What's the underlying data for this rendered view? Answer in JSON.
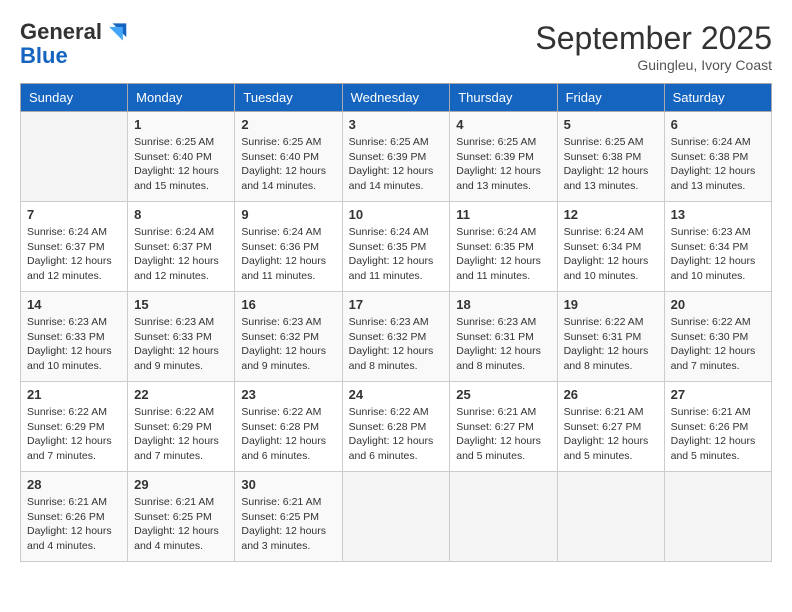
{
  "header": {
    "logo_line1": "General",
    "logo_line2": "Blue",
    "month_title": "September 2025",
    "subtitle": "Guingleu, Ivory Coast"
  },
  "days_of_week": [
    "Sunday",
    "Monday",
    "Tuesday",
    "Wednesday",
    "Thursday",
    "Friday",
    "Saturday"
  ],
  "weeks": [
    [
      {
        "day": "",
        "info": ""
      },
      {
        "day": "1",
        "info": "Sunrise: 6:25 AM\nSunset: 6:40 PM\nDaylight: 12 hours\nand 15 minutes."
      },
      {
        "day": "2",
        "info": "Sunrise: 6:25 AM\nSunset: 6:40 PM\nDaylight: 12 hours\nand 14 minutes."
      },
      {
        "day": "3",
        "info": "Sunrise: 6:25 AM\nSunset: 6:39 PM\nDaylight: 12 hours\nand 14 minutes."
      },
      {
        "day": "4",
        "info": "Sunrise: 6:25 AM\nSunset: 6:39 PM\nDaylight: 12 hours\nand 13 minutes."
      },
      {
        "day": "5",
        "info": "Sunrise: 6:25 AM\nSunset: 6:38 PM\nDaylight: 12 hours\nand 13 minutes."
      },
      {
        "day": "6",
        "info": "Sunrise: 6:24 AM\nSunset: 6:38 PM\nDaylight: 12 hours\nand 13 minutes."
      }
    ],
    [
      {
        "day": "7",
        "info": "Sunrise: 6:24 AM\nSunset: 6:37 PM\nDaylight: 12 hours\nand 12 minutes."
      },
      {
        "day": "8",
        "info": "Sunrise: 6:24 AM\nSunset: 6:37 PM\nDaylight: 12 hours\nand 12 minutes."
      },
      {
        "day": "9",
        "info": "Sunrise: 6:24 AM\nSunset: 6:36 PM\nDaylight: 12 hours\nand 11 minutes."
      },
      {
        "day": "10",
        "info": "Sunrise: 6:24 AM\nSunset: 6:35 PM\nDaylight: 12 hours\nand 11 minutes."
      },
      {
        "day": "11",
        "info": "Sunrise: 6:24 AM\nSunset: 6:35 PM\nDaylight: 12 hours\nand 11 minutes."
      },
      {
        "day": "12",
        "info": "Sunrise: 6:24 AM\nSunset: 6:34 PM\nDaylight: 12 hours\nand 10 minutes."
      },
      {
        "day": "13",
        "info": "Sunrise: 6:23 AM\nSunset: 6:34 PM\nDaylight: 12 hours\nand 10 minutes."
      }
    ],
    [
      {
        "day": "14",
        "info": "Sunrise: 6:23 AM\nSunset: 6:33 PM\nDaylight: 12 hours\nand 10 minutes."
      },
      {
        "day": "15",
        "info": "Sunrise: 6:23 AM\nSunset: 6:33 PM\nDaylight: 12 hours\nand 9 minutes."
      },
      {
        "day": "16",
        "info": "Sunrise: 6:23 AM\nSunset: 6:32 PM\nDaylight: 12 hours\nand 9 minutes."
      },
      {
        "day": "17",
        "info": "Sunrise: 6:23 AM\nSunset: 6:32 PM\nDaylight: 12 hours\nand 8 minutes."
      },
      {
        "day": "18",
        "info": "Sunrise: 6:23 AM\nSunset: 6:31 PM\nDaylight: 12 hours\nand 8 minutes."
      },
      {
        "day": "19",
        "info": "Sunrise: 6:22 AM\nSunset: 6:31 PM\nDaylight: 12 hours\nand 8 minutes."
      },
      {
        "day": "20",
        "info": "Sunrise: 6:22 AM\nSunset: 6:30 PM\nDaylight: 12 hours\nand 7 minutes."
      }
    ],
    [
      {
        "day": "21",
        "info": "Sunrise: 6:22 AM\nSunset: 6:29 PM\nDaylight: 12 hours\nand 7 minutes."
      },
      {
        "day": "22",
        "info": "Sunrise: 6:22 AM\nSunset: 6:29 PM\nDaylight: 12 hours\nand 7 minutes."
      },
      {
        "day": "23",
        "info": "Sunrise: 6:22 AM\nSunset: 6:28 PM\nDaylight: 12 hours\nand 6 minutes."
      },
      {
        "day": "24",
        "info": "Sunrise: 6:22 AM\nSunset: 6:28 PM\nDaylight: 12 hours\nand 6 minutes."
      },
      {
        "day": "25",
        "info": "Sunrise: 6:21 AM\nSunset: 6:27 PM\nDaylight: 12 hours\nand 5 minutes."
      },
      {
        "day": "26",
        "info": "Sunrise: 6:21 AM\nSunset: 6:27 PM\nDaylight: 12 hours\nand 5 minutes."
      },
      {
        "day": "27",
        "info": "Sunrise: 6:21 AM\nSunset: 6:26 PM\nDaylight: 12 hours\nand 5 minutes."
      }
    ],
    [
      {
        "day": "28",
        "info": "Sunrise: 6:21 AM\nSunset: 6:26 PM\nDaylight: 12 hours\nand 4 minutes."
      },
      {
        "day": "29",
        "info": "Sunrise: 6:21 AM\nSunset: 6:25 PM\nDaylight: 12 hours\nand 4 minutes."
      },
      {
        "day": "30",
        "info": "Sunrise: 6:21 AM\nSunset: 6:25 PM\nDaylight: 12 hours\nand 3 minutes."
      },
      {
        "day": "",
        "info": ""
      },
      {
        "day": "",
        "info": ""
      },
      {
        "day": "",
        "info": ""
      },
      {
        "day": "",
        "info": ""
      }
    ]
  ]
}
